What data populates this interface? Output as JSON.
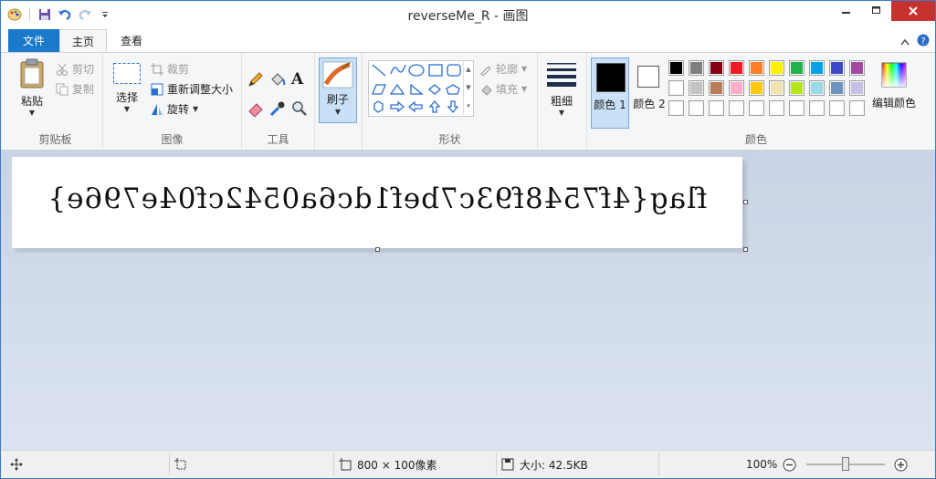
{
  "window": {
    "title": "reverseMe_R - 画图",
    "buttons": [
      "minimize",
      "maximize",
      "close"
    ]
  },
  "tabs": {
    "file": "文件",
    "home": "主页",
    "view": "查看"
  },
  "clipboard": {
    "paste": "粘贴",
    "cut": "剪切",
    "copy": "复制",
    "label": "剪贴板"
  },
  "image": {
    "select": "选择",
    "crop": "裁剪",
    "resize": "重新调整大小",
    "rotate": "旋转",
    "label": "图像"
  },
  "tools": {
    "label": "工具"
  },
  "brushes": {
    "label": "刷子"
  },
  "shapes": {
    "outline": "轮廓",
    "fill": "填充",
    "label": "形状"
  },
  "size": {
    "label": "粗细"
  },
  "colors": {
    "color1": "颜色 1",
    "color2": "颜色 2",
    "edit": "编辑颜色",
    "label": "颜色",
    "color1_value": "#000000",
    "color2_value": "#ffffff",
    "palette_row1": [
      "#000000",
      "#7f7f7f",
      "#880015",
      "#ed1c24",
      "#ff7f27",
      "#fff200",
      "#22b14c",
      "#00a2e8",
      "#3f48cc",
      "#a349a4"
    ],
    "palette_row2": [
      "#ffffff",
      "#c3c3c3",
      "#b97a57",
      "#ffaec9",
      "#ffc90e",
      "#efe4b0",
      "#b5e61d",
      "#99d9ea",
      "#7092be",
      "#c8bfe7"
    ],
    "palette_row3": [
      "#ffffff",
      "#ffffff",
      "#ffffff",
      "#ffffff",
      "#ffffff",
      "#ffffff",
      "#ffffff",
      "#ffffff",
      "#ffffff",
      "#ffffff"
    ]
  },
  "canvas": {
    "text": "flag{4f7548f93c7bef1dc6a0542cf04e796e}"
  },
  "status": {
    "dimensions": "800 × 100像素",
    "size": "大小: 42.5KB",
    "zoom": "100%",
    "zoom_slider": 0.5
  }
}
